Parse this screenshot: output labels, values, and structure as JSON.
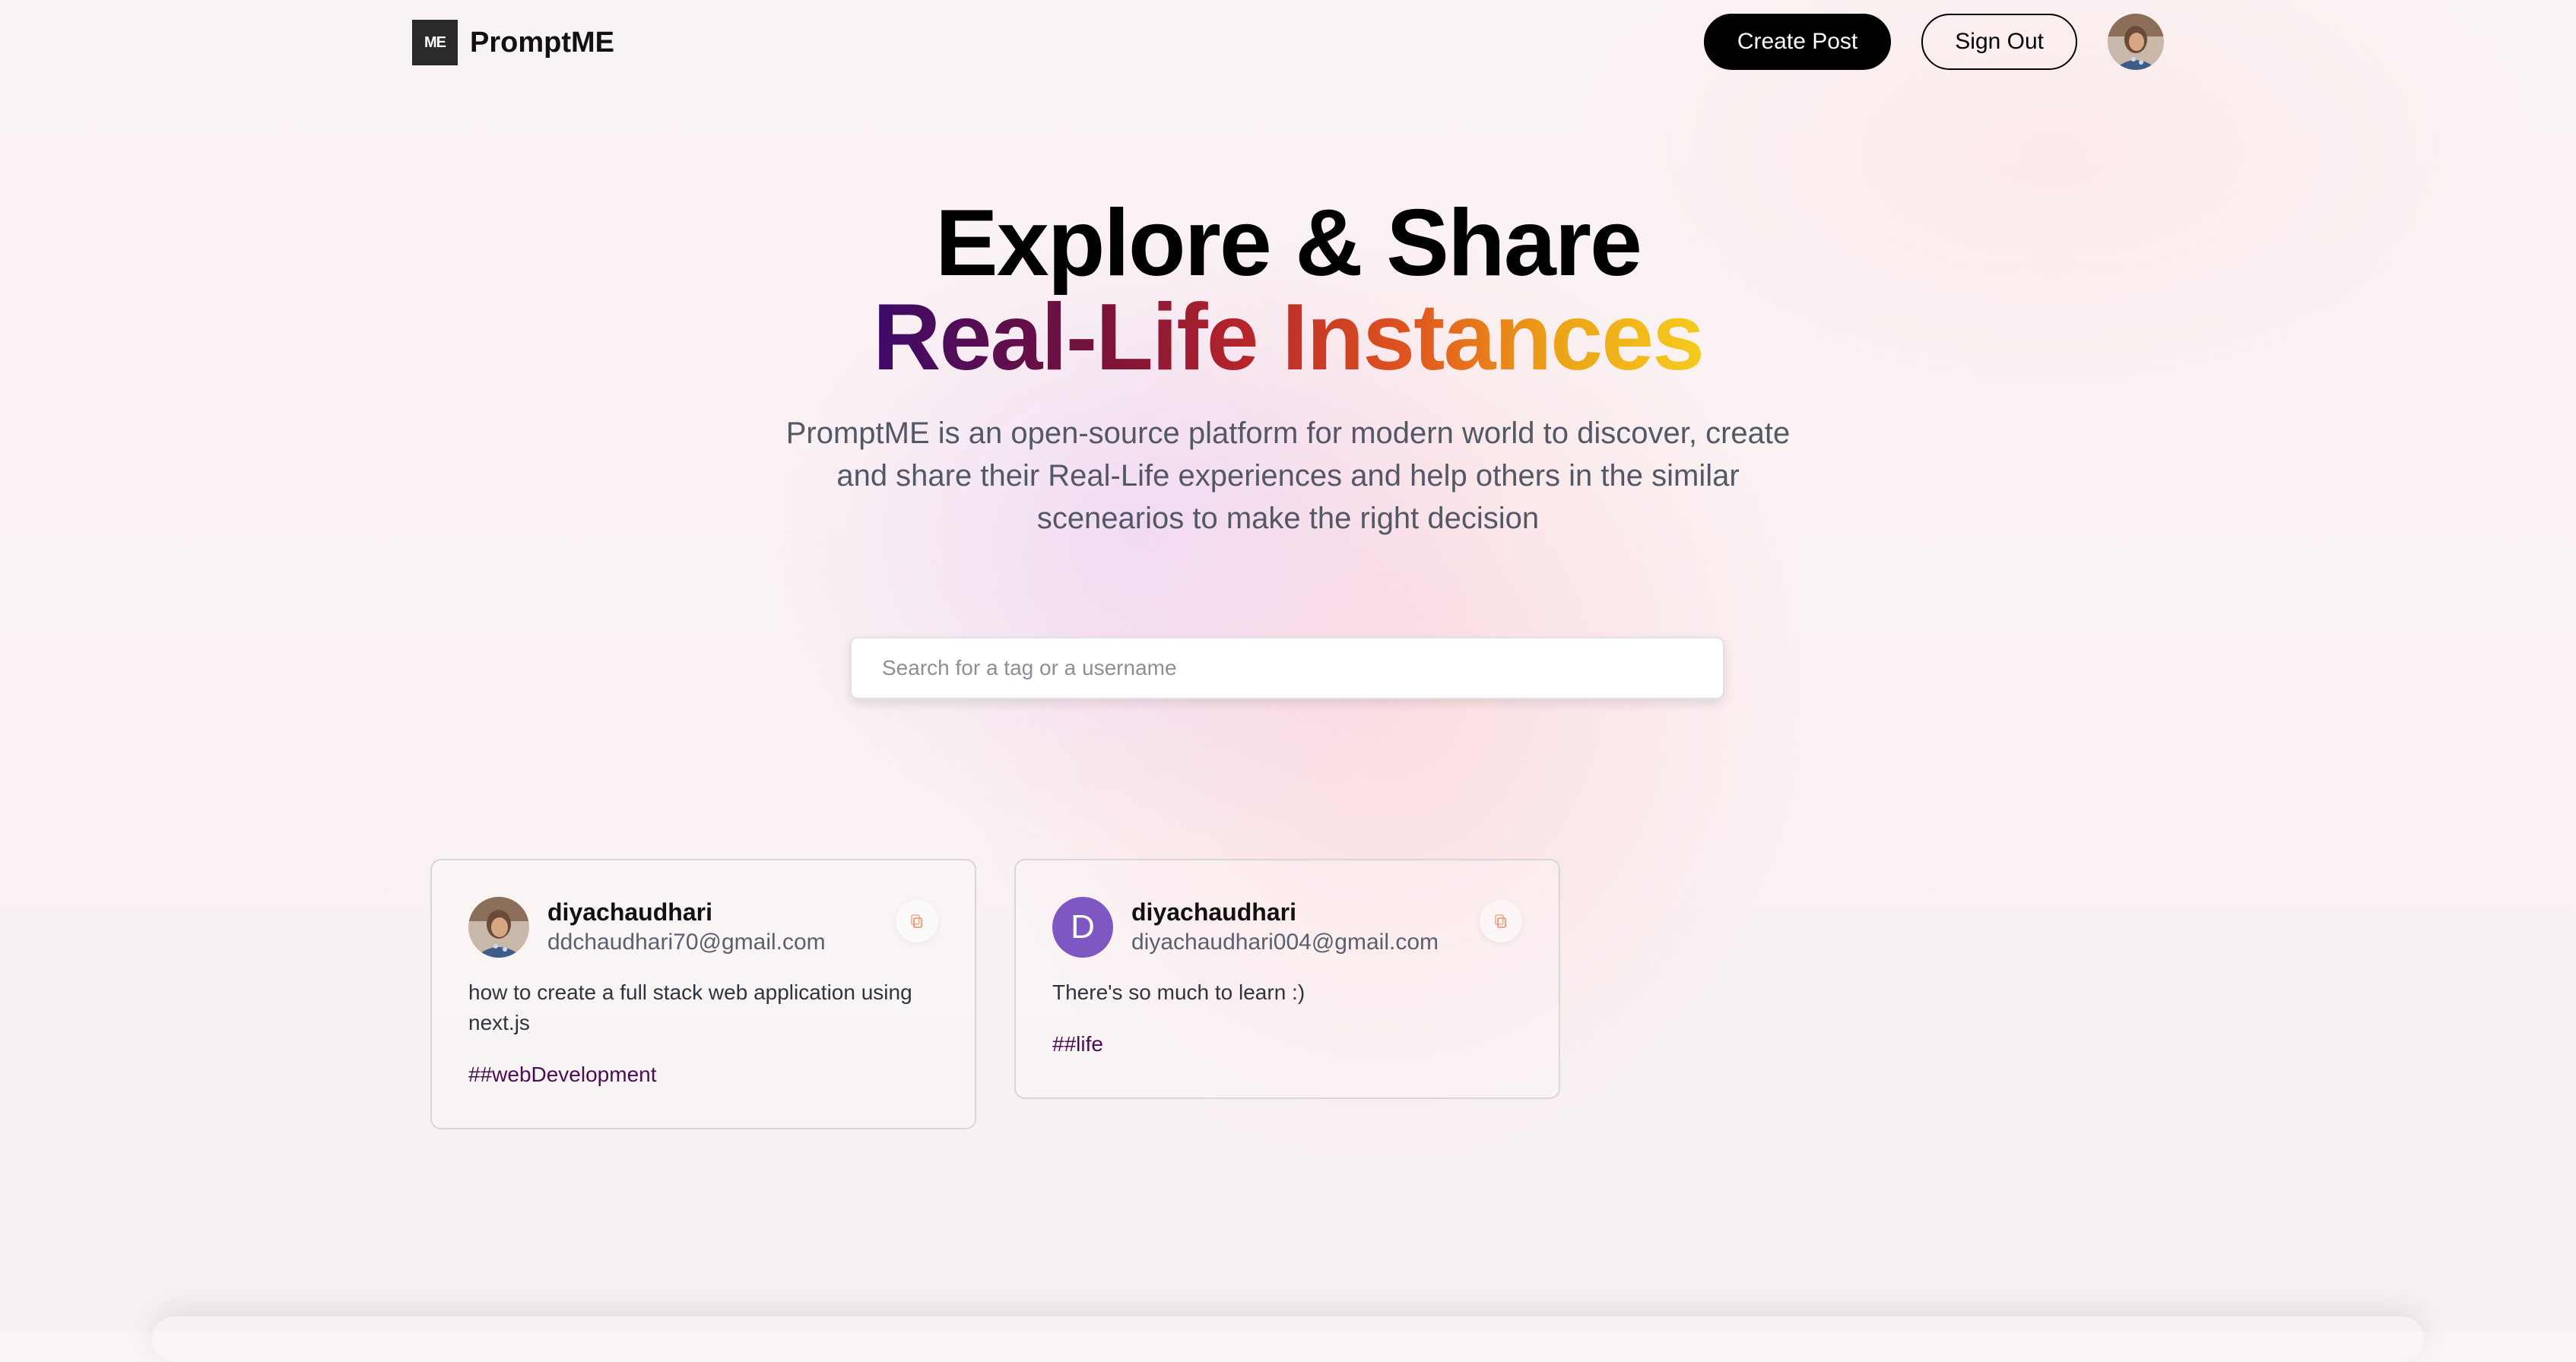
{
  "brand": {
    "logo_mark": "ME",
    "name": "PromptME"
  },
  "nav": {
    "create_post": "Create Post",
    "sign_out": "Sign Out"
  },
  "hero": {
    "title_line1": "Explore & Share",
    "title_line2": "Real-Life Instances",
    "description": "PromptME is an open-source platform for modern world to discover, create and share their Real-Life experiences and help others in the similar scenearios to make the right decision"
  },
  "search": {
    "placeholder": "Search for a tag or a username",
    "value": ""
  },
  "posts": [
    {
      "username": "diyachaudhari",
      "email": "ddchaudhari70@gmail.com",
      "prompt": "how to create a full stack web application using next.js",
      "tag": "##webDevelopment",
      "avatar": "photo"
    },
    {
      "username": "diyachaudhari",
      "email": "diyachaudhari004@gmail.com",
      "prompt": "There's so much to learn :)",
      "tag": "##life",
      "avatar_letter": "D"
    }
  ],
  "colors": {
    "accent_dark": "#000000",
    "tag_color": "#4a0c52",
    "letter_avatar": "#7e57c2",
    "copy_icon": "#f08a5d",
    "gradient": [
      "#3b0a69",
      "#7a1338",
      "#b8252a",
      "#e0561f",
      "#eda117",
      "#f5cc1e"
    ]
  },
  "icons": {
    "copy": "copy-icon",
    "profile": "profile-photo"
  }
}
